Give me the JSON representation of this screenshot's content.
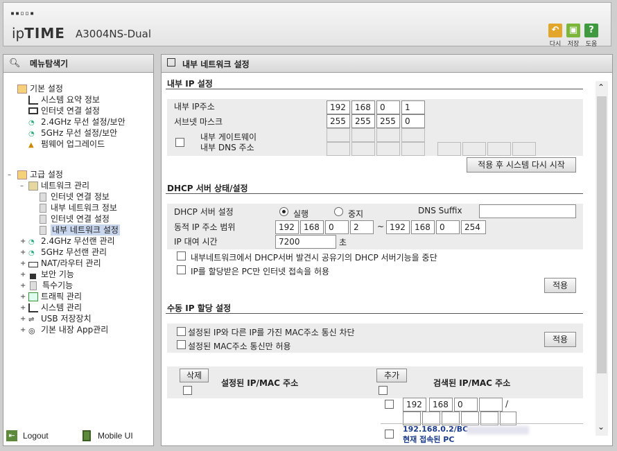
{
  "header": {
    "logo_dots": "▪▪▫▫▪",
    "logo_ip": "ip",
    "logo_time": "TIME",
    "model": "A3004NS-Dual",
    "buttons": [
      {
        "label": "다시",
        "icon": "undo-icon",
        "color": "#e2a62a"
      },
      {
        "label": "저장",
        "icon": "save-icon",
        "color": "#7bb63a"
      },
      {
        "label": "도움",
        "icon": "help-icon",
        "color": "#3f9a3f"
      }
    ]
  },
  "left": {
    "title": "메뉴탐색기",
    "basic": {
      "label": "기본 설정",
      "items": [
        "시스템 요약 정보",
        "인터넷 연결 설정",
        "2.4GHz 무선 설정/보안",
        "5GHz 무선 설정/보안",
        "펌웨어 업그레이드"
      ]
    },
    "advanced": {
      "label": "고급 설정",
      "network": {
        "label": "네트워크 관리",
        "items": [
          "인터넷 연결 정보",
          "내부 네트워크 정보",
          "인터넷 연결 설정",
          "내부 네트워크 설정"
        ]
      },
      "items": [
        "2.4GHz 무선랜 관리",
        "5GHz 무선랜 관리",
        "NAT/라우터 관리",
        "보안 기능",
        "특수기능",
        "트래픽 관리",
        "시스템 관리",
        "USB 저장장치",
        "기본 내장 App관리"
      ]
    },
    "footer": {
      "logout": "Logout",
      "mobile": "Mobile UI"
    }
  },
  "main": {
    "title": "내부 네트워크 설정",
    "internal_ip": {
      "heading": "내부 IP 설정",
      "ip_label": "내부 IP주소",
      "ip": [
        "192",
        "168",
        "0",
        "1"
      ],
      "mask_label": "서브넷 마스크",
      "mask": [
        "255",
        "255",
        "255",
        "0"
      ],
      "gw_label": "내부 게이트웨이",
      "dns_label": "내부 DNS 주소",
      "apply_restart": "적용 후 시스템 다시 시작"
    },
    "dhcp": {
      "heading": "DHCP 서버 상태/설정",
      "server_label": "DHCP 서버 설정",
      "run": "실행",
      "stop": "중지",
      "dns_suffix_label": "DNS Suffix",
      "dns_suffix": "",
      "range_label": "동적 IP 주소 범위",
      "start": [
        "192",
        "168",
        "0",
        "2"
      ],
      "tilde": "~",
      "end": [
        "192",
        "168",
        "0",
        "254"
      ],
      "lease_label": "IP 대여 시간",
      "lease": "7200",
      "lease_unit": "초",
      "opt1": "내부네트워크에서 DHCP서버 발견시 공유기의 DHCP 서버기능을 중단",
      "opt2": "IP를 할당받은 PC만 인터넷 접속을 허용",
      "apply": "적용"
    },
    "manual": {
      "heading": "수동 IP 할당 설정",
      "opt1": "설정된 IP와 다른 IP를 가진 MAC주소 통신 차단",
      "opt2": "설정된 MAC주소 통신만 허용",
      "apply": "적용",
      "delete": "삭제",
      "configured": "설정된 IP/MAC 주소",
      "add": "추가",
      "found": "검색된 IP/MAC 주소",
      "new_ip": [
        "192",
        "168",
        "0",
        ""
      ],
      "slash": "/",
      "pc_ip": "192.168.0.2/BC-",
      "pc_note": "현재 접속된 PC"
    }
  }
}
